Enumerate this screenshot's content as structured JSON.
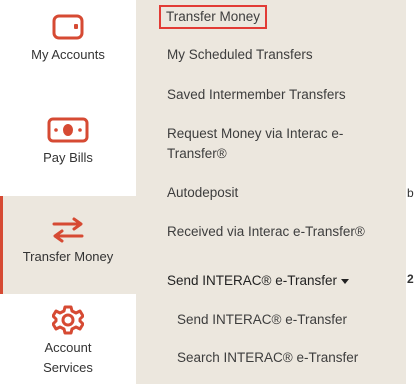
{
  "sidebar": {
    "items": [
      {
        "label": "My Accounts",
        "icon": "wallet-icon",
        "active": false
      },
      {
        "label": "Pay Bills",
        "icon": "banknote-icon",
        "active": false
      },
      {
        "label": "Transfer Money",
        "icon": "transfer-arrows-icon",
        "active": true
      },
      {
        "label": "Account Services",
        "icon": "gear-icon",
        "active": false
      }
    ]
  },
  "submenu": {
    "links": [
      {
        "label": "Transfer Money"
      },
      {
        "label": "My Scheduled Transfers"
      },
      {
        "label": "Saved Intermember Transfers"
      },
      {
        "label": "Request Money via Interac e-Transfer®"
      },
      {
        "label": "Autodeposit"
      },
      {
        "label": "Received via Interac e-Transfer®"
      }
    ],
    "send_interac": {
      "label": "Send INTERAC® e-Transfer",
      "items": [
        {
          "label": "Send INTERAC® e-Transfer"
        },
        {
          "label": "Search INTERAC® e-Transfer"
        }
      ]
    }
  },
  "right_edge": {
    "fragment_1": "b",
    "fragment_2": "2"
  },
  "colors": {
    "accent": "#d64a33",
    "highlight_border": "#e23b35",
    "submenu_bg": "#ece7de"
  }
}
